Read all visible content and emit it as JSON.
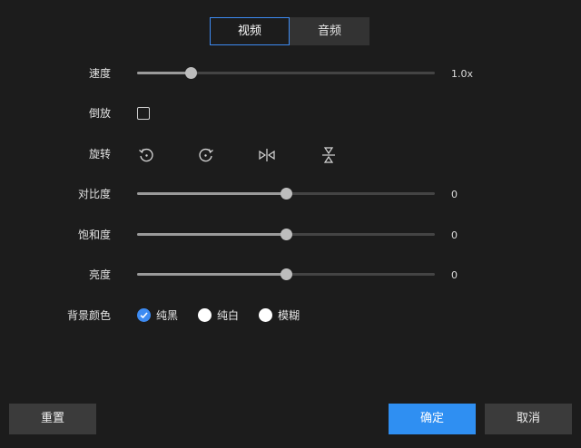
{
  "tabs": [
    {
      "label": "视频",
      "active": true
    },
    {
      "label": "音频",
      "active": false
    }
  ],
  "speed": {
    "label": "速度",
    "value_text": "1.0x",
    "fraction": 0.18
  },
  "reverse": {
    "label": "倒放",
    "checked": false
  },
  "rotate": {
    "label": "旋转",
    "icons": [
      "rotate-left-icon",
      "rotate-right-icon",
      "flip-horizontal-icon",
      "flip-vertical-icon"
    ]
  },
  "contrast": {
    "label": "对比度",
    "value_text": "0",
    "fraction": 0.5
  },
  "saturation": {
    "label": "饱和度",
    "value_text": "0",
    "fraction": 0.5
  },
  "brightness": {
    "label": "亮度",
    "value_text": "0",
    "fraction": 0.5
  },
  "background": {
    "label": "背景颜色",
    "options": [
      {
        "label": "纯黑",
        "checked": true
      },
      {
        "label": "纯白",
        "checked": false
      },
      {
        "label": "模糊",
        "checked": false
      }
    ]
  },
  "buttons": {
    "reset": "重置",
    "confirm": "确定",
    "cancel": "取消"
  },
  "colors": {
    "accent": "#2f8ff2",
    "background": "#1c1c1c"
  }
}
